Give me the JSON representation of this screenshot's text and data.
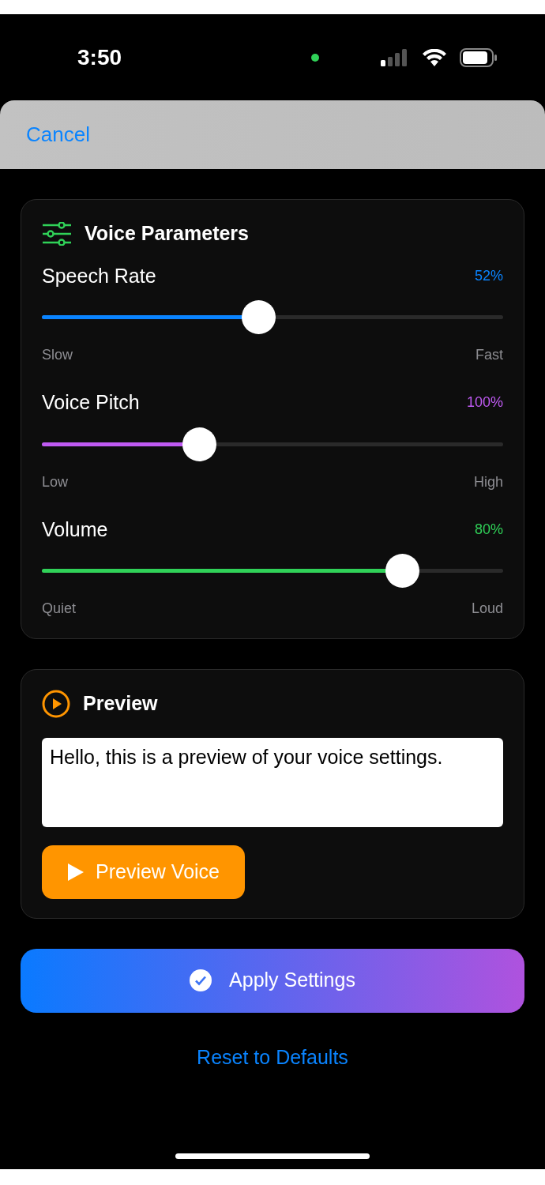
{
  "status_bar": {
    "time": "3:50"
  },
  "header": {
    "cancel": "Cancel"
  },
  "voice_parameters": {
    "title": "Voice Parameters",
    "sliders": [
      {
        "label": "Speech Rate",
        "reading": "52%",
        "level": 0.47,
        "color": "#0a84ff",
        "min_label": "Slow",
        "max_label": "Fast"
      },
      {
        "label": "Voice Pitch",
        "reading": "100%",
        "level": 0.34,
        "color": "#bf5af2",
        "min_label": "Low",
        "max_label": "High"
      },
      {
        "label": "Volume",
        "reading": "80%",
        "level": 0.78,
        "color": "#30d158",
        "min_label": "Quiet",
        "max_label": "Loud"
      }
    ]
  },
  "preview": {
    "title": "Preview",
    "text": "Hello, this is a preview of your voice settings.",
    "button": "Preview Voice"
  },
  "apply_button": "Apply Settings",
  "reset_link": "Reset to Defaults"
}
